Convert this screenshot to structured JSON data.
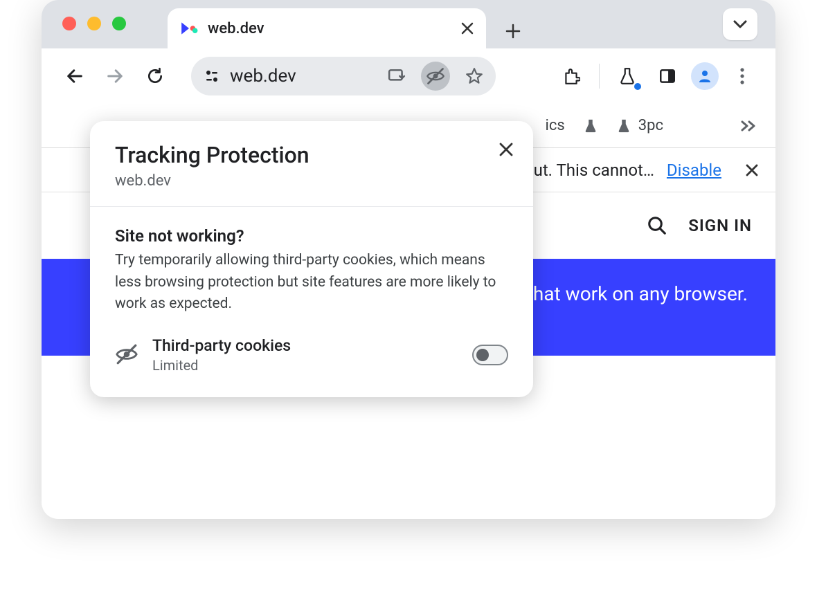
{
  "tab": {
    "title": "web.dev"
  },
  "toolbar": {
    "url": "web.dev"
  },
  "bookmarks": {
    "item_partial": "ics",
    "item_3pc": "3pc"
  },
  "infobar": {
    "text_fragment": "ut. This cannot…",
    "disable": "Disable"
  },
  "page": {
    "signin": "SIGN IN",
    "banner_fragment": "that work on any browser."
  },
  "popover": {
    "title": "Tracking Protection",
    "site": "web.dev",
    "question": "Site not working?",
    "description": "Try temporarily allowing third-party cookies, which means less browsing protection but site features are more likely to work as expected.",
    "tp_label": "Third-party cookies",
    "tp_status": "Limited"
  }
}
